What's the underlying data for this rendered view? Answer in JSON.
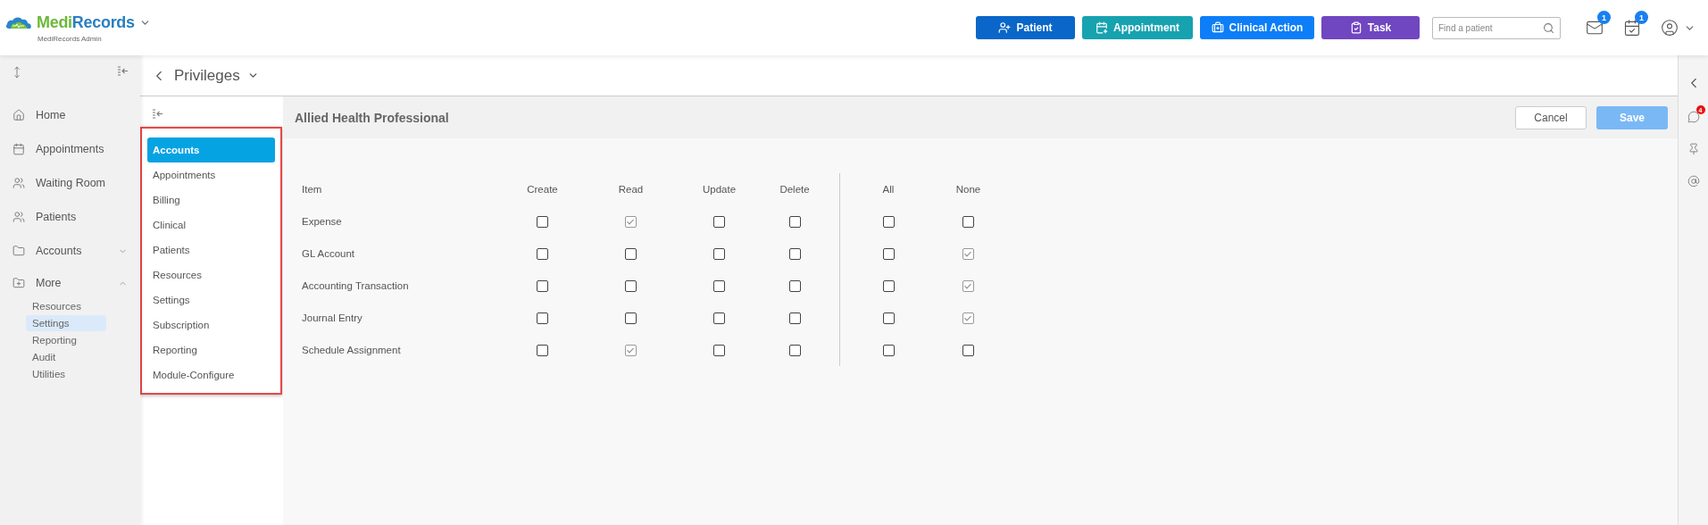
{
  "header": {
    "brand_prefix": "Medi",
    "brand_suffix": "Records",
    "brand_subtitle": "MediRecords Admin",
    "actions": [
      {
        "kind": "patient",
        "label": "Patient",
        "color": "#0a66c8"
      },
      {
        "kind": "appointment",
        "label": "Appointment",
        "color": "#17a2b0"
      },
      {
        "kind": "clinical",
        "label": "Clinical Action",
        "color": "#0d7ef7"
      },
      {
        "kind": "task",
        "label": "Task",
        "color": "#7046c1"
      }
    ],
    "search": {
      "placeholder": "Find a patient"
    },
    "notifications": [
      {
        "kind": "mail",
        "badge": "1"
      },
      {
        "kind": "calendar",
        "badge": "1"
      }
    ]
  },
  "sidebar": {
    "items": [
      {
        "kind": "home",
        "label": "Home"
      },
      {
        "kind": "appointments",
        "label": "Appointments"
      },
      {
        "kind": "waiting",
        "label": "Waiting Room"
      },
      {
        "kind": "patients",
        "label": "Patients"
      },
      {
        "kind": "accounts",
        "label": "Accounts",
        "expanded": false
      },
      {
        "kind": "more",
        "label": "More",
        "expanded": true,
        "children": [
          {
            "label": "Resources",
            "selected": false
          },
          {
            "label": "Settings",
            "selected": true
          },
          {
            "label": "Reporting",
            "selected": false
          },
          {
            "label": "Audit",
            "selected": false
          },
          {
            "label": "Utilities",
            "selected": false
          }
        ]
      }
    ]
  },
  "page_title": "Privileges",
  "subnav": {
    "items": [
      {
        "label": "Accounts",
        "selected": true
      },
      {
        "label": "Appointments",
        "selected": false
      },
      {
        "label": "Billing",
        "selected": false
      },
      {
        "label": "Clinical",
        "selected": false
      },
      {
        "label": "Patients",
        "selected": false
      },
      {
        "label": "Resources",
        "selected": false
      },
      {
        "label": "Settings",
        "selected": false
      },
      {
        "label": "Subscription",
        "selected": false
      },
      {
        "label": "Reporting",
        "selected": false
      },
      {
        "label": "Module-Configure",
        "selected": false
      }
    ]
  },
  "panel": {
    "title": "Allied Health Professional",
    "buttons": [
      {
        "kind": "cancel",
        "label": "Cancel"
      },
      {
        "kind": "save",
        "label": "Save",
        "disabled": true
      }
    ]
  },
  "table": {
    "columns": [
      "Item",
      "Create",
      "Read",
      "Update",
      "Delete",
      "All",
      "None"
    ],
    "rows": [
      {
        "item": "Expense",
        "checks": [
          false,
          true,
          false,
          false,
          false,
          false
        ]
      },
      {
        "item": "GL Account",
        "checks": [
          false,
          false,
          false,
          false,
          false,
          true
        ]
      },
      {
        "item": "Accounting Transaction",
        "checks": [
          false,
          false,
          false,
          false,
          false,
          true
        ]
      },
      {
        "item": "Journal Entry",
        "checks": [
          false,
          false,
          false,
          false,
          false,
          true
        ]
      },
      {
        "item": "Schedule Assignment",
        "checks": [
          false,
          true,
          false,
          false,
          false,
          false
        ]
      }
    ]
  },
  "right_rail": {
    "chat_badge": "4"
  }
}
